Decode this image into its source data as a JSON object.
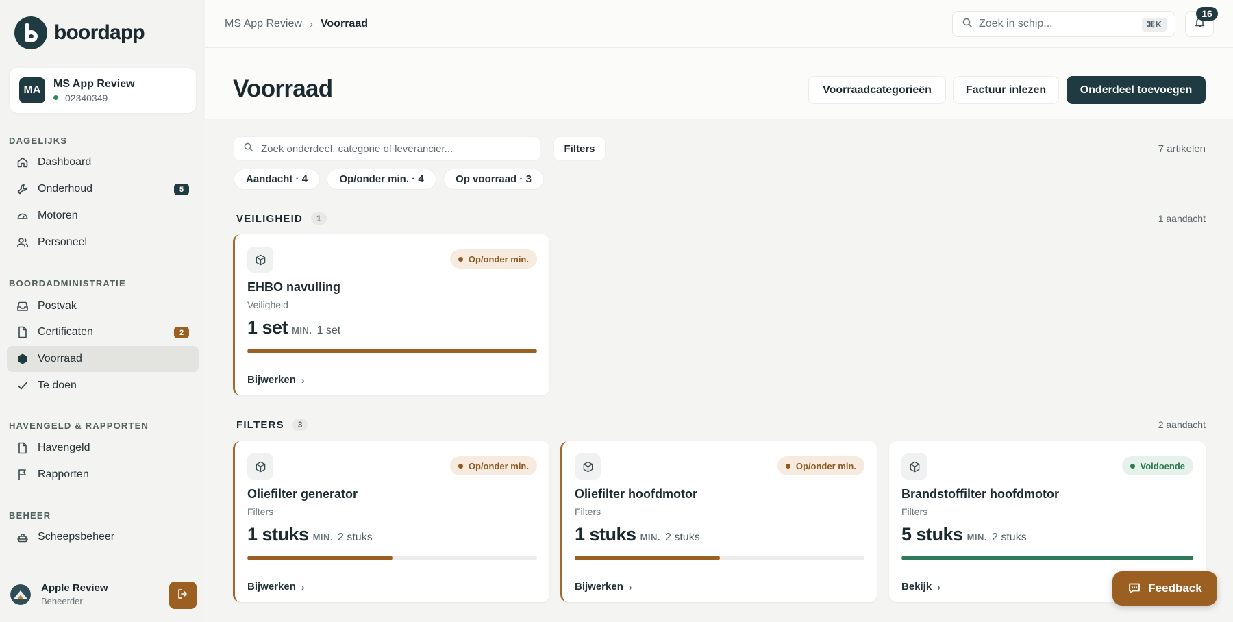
{
  "brand": {
    "name": "boordapp"
  },
  "vessel": {
    "initials": "MA",
    "name": "MS App Review",
    "id": "02340349"
  },
  "nav": {
    "sections": [
      {
        "title": "DAGELIJKS"
      },
      {
        "title": "BOORDADMINISTRATIE"
      },
      {
        "title": "HAVENGELD & RAPPORTEN"
      },
      {
        "title": "BEHEER"
      }
    ],
    "items": [
      {
        "label": "Dashboard",
        "icon": "home-icon"
      },
      {
        "label": "Onderhoud",
        "icon": "wrench-icon",
        "badge": "5",
        "badge_color": "#1f3a40"
      },
      {
        "label": "Motoren",
        "icon": "gauge-icon"
      },
      {
        "label": "Personeel",
        "icon": "users-icon"
      },
      {
        "label": "Postvak",
        "icon": "inbox-icon"
      },
      {
        "label": "Certificaten",
        "icon": "document-icon",
        "badge": "2",
        "badge_color": "#9a5f21"
      },
      {
        "label": "Voorraad",
        "icon": "box-icon",
        "active": true
      },
      {
        "label": "Te doen",
        "icon": "check-icon"
      },
      {
        "label": "Havengeld",
        "icon": "document-icon"
      },
      {
        "label": "Rapporten",
        "icon": "flag-icon"
      },
      {
        "label": "Scheepsbeheer",
        "icon": "ship-icon"
      }
    ]
  },
  "user": {
    "name": "Apple Review",
    "role": "Beheerder"
  },
  "topbar": {
    "breadcrumb": [
      "MS App Review",
      "Voorraad"
    ],
    "search_placeholder": "Zoek in schip...",
    "search_shortcut": "⌘K",
    "notification_count": "16"
  },
  "header": {
    "title": "Voorraad",
    "buttons": [
      "Voorraadcategorieën",
      "Factuur inlezen",
      "Onderdeel toevoegen"
    ]
  },
  "toolbar": {
    "search_placeholder": "Zoek onderdeel, categorie of leverancier...",
    "filters_label": "Filters",
    "count_text": "7 artikelen",
    "chips": [
      "Aandacht · 4",
      "Op/onder min. · 4",
      "Op voorraad · 3"
    ]
  },
  "sections": [
    {
      "title": "VEILIGHEID",
      "count": "1",
      "note": "1 aandacht",
      "cards": [
        {
          "title": "EHBO navulling",
          "category": "Veiligheid",
          "qty": "1 set",
          "min_label": "MIN.",
          "min": "1 set",
          "status": "Op/onder min.",
          "status_type": "warn",
          "fill": 1.0,
          "fill_color": "#9a5f21",
          "action": "Bijwerken"
        }
      ]
    },
    {
      "title": "FILTERS",
      "count": "3",
      "note": "2 aandacht",
      "cards": [
        {
          "title": "Oliefilter generator",
          "category": "Filters",
          "qty": "1 stuks",
          "min_label": "MIN.",
          "min": "2 stuks",
          "status": "Op/onder min.",
          "status_type": "warn",
          "fill": 0.5,
          "fill_color": "#9a5f21",
          "action": "Bijwerken"
        },
        {
          "title": "Oliefilter hoofdmotor",
          "category": "Filters",
          "qty": "1 stuks",
          "min_label": "MIN.",
          "min": "2 stuks",
          "status": "Op/onder min.",
          "status_type": "warn",
          "fill": 0.5,
          "fill_color": "#9a5f21",
          "action": "Bijwerken"
        },
        {
          "title": "Brandstoffilter hoofdmotor",
          "category": "Filters",
          "qty": "5 stuks",
          "min_label": "MIN.",
          "min": "2 stuks",
          "status": "Voldoende",
          "status_type": "ok",
          "fill": 1.0,
          "fill_color": "#2f7a5a",
          "action": "Bekijk"
        }
      ]
    }
  ],
  "feedback": {
    "label": "Feedback"
  }
}
